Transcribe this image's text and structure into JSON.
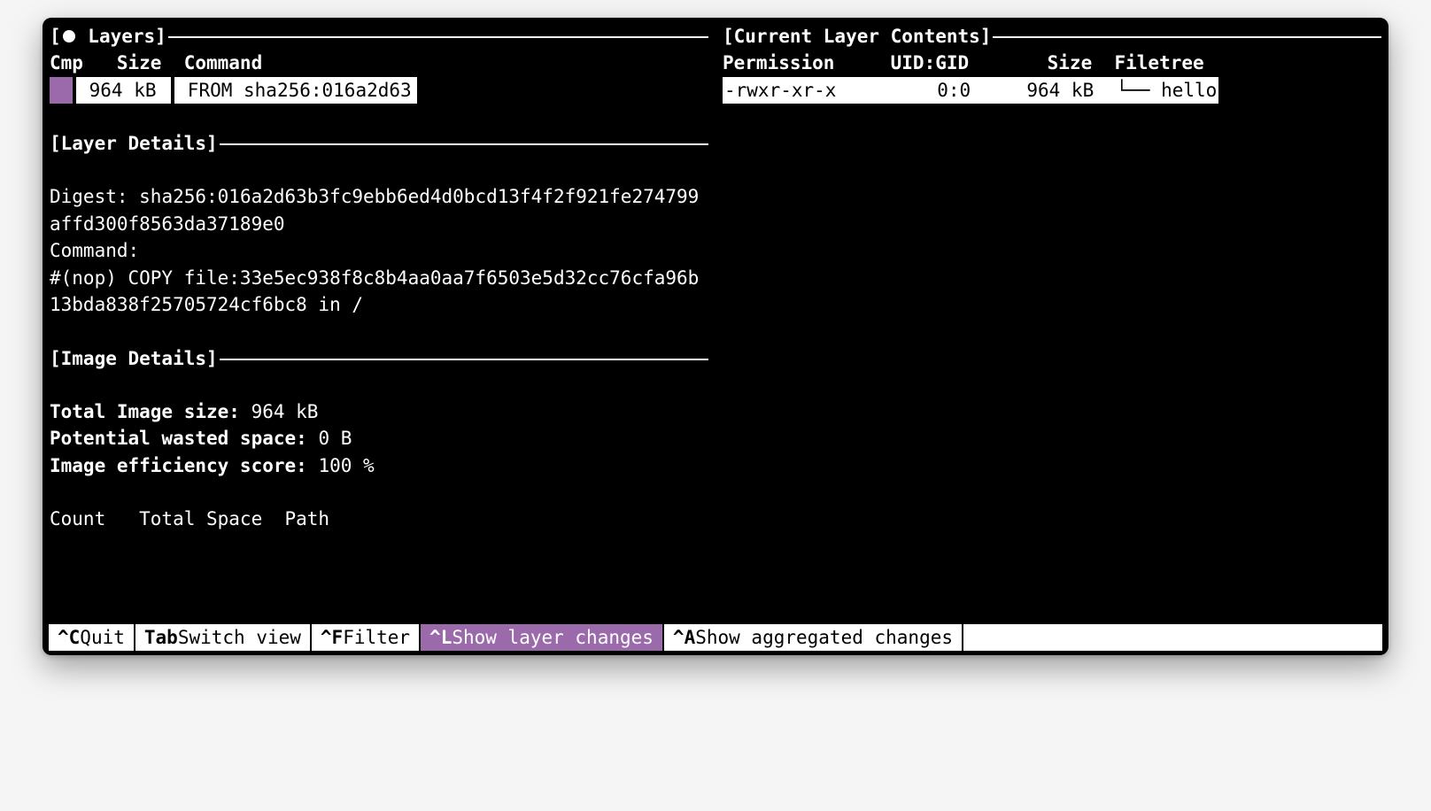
{
  "panes": {
    "layers": {
      "title": "[● Layers]",
      "cols": "Cmp   Size  Command",
      "row": {
        "size": " 964 kB ",
        "command": " FROM sha256:016a2d63"
      }
    },
    "layer_details": {
      "title": "[Layer Details]",
      "digest_label": "Digest: ",
      "digest": "sha256:016a2d63b3fc9ebb6ed4d0bcd13f4f2f921fe274799affd300f8563da37189e0",
      "command_label": "Command:",
      "command": "#(nop) COPY file:33e5ec938f8c8b4aa0aa7f6503e5d32cc76cfa96b13bda838f25705724cf6bc8 in / "
    },
    "image_details": {
      "title": "[Image Details]",
      "total_label": "Total Image size: ",
      "total_value": "964 kB",
      "wasted_label": "Potential wasted space: ",
      "wasted_value": "0 B",
      "efficiency_label": "Image efficiency score: ",
      "efficiency_value": "100 %",
      "table_header": "Count   Total Space  Path"
    },
    "contents": {
      "title": "[Current Layer Contents]",
      "cols": "Permission     UID:GID       Size  Filetree",
      "row": "-rwxr-xr-x         0:0     964 kB  └── hello"
    }
  },
  "bottombar": {
    "quit": {
      "key": "^C",
      "label": "Quit"
    },
    "switch": {
      "key": "Tab",
      "label": "Switch view"
    },
    "filter": {
      "key": "^F",
      "label": "Filter"
    },
    "layerch": {
      "key": "^L",
      "label": "Show layer changes"
    },
    "aggch": {
      "key": "^A",
      "label": "Show aggregated changes"
    }
  }
}
